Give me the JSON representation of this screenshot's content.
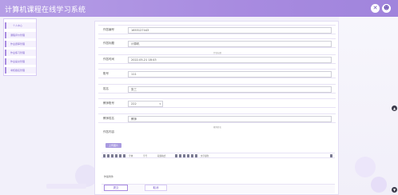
{
  "header": {
    "title": "计算机课程在线学习系统",
    "close_icon": "✕",
    "user_icon": "☻"
  },
  "sidebar": {
    "items": [
      {
        "label": "个人中心"
      },
      {
        "label": "课程评价管理"
      },
      {
        "label": "作业题库管理"
      },
      {
        "label": "作业练习管理"
      },
      {
        "label": "作业提交管理"
      },
      {
        "label": "考核报名管理"
      }
    ]
  },
  "form": {
    "rows": [
      {
        "label": "作答编号",
        "value": "1653127443"
      },
      {
        "label": "作答标题",
        "value": "计算机",
        "note": "作答标题"
      },
      {
        "label": "作答时间",
        "value": "2022-05-21 18:43"
      },
      {
        "label": "账号",
        "value": "111"
      },
      {
        "label": "姓名",
        "value": "张三"
      },
      {
        "label": "教师账号",
        "value": "222",
        "kind": "select"
      },
      {
        "label": "教师姓名",
        "value": "教师",
        "note": "教师姓名"
      }
    ],
    "editor_label": "作答内容",
    "upload_label": "上传图片",
    "toolbar_items": [
      "字体",
      "字号",
      "段落格式",
      "文字颜色"
    ],
    "editor_footer": "作答附件",
    "submit_label": "提交",
    "cancel_label": "取消"
  },
  "colors": {
    "accent": "#a88be0",
    "header_start": "#b59ee6",
    "header_end": "#a084dc"
  }
}
